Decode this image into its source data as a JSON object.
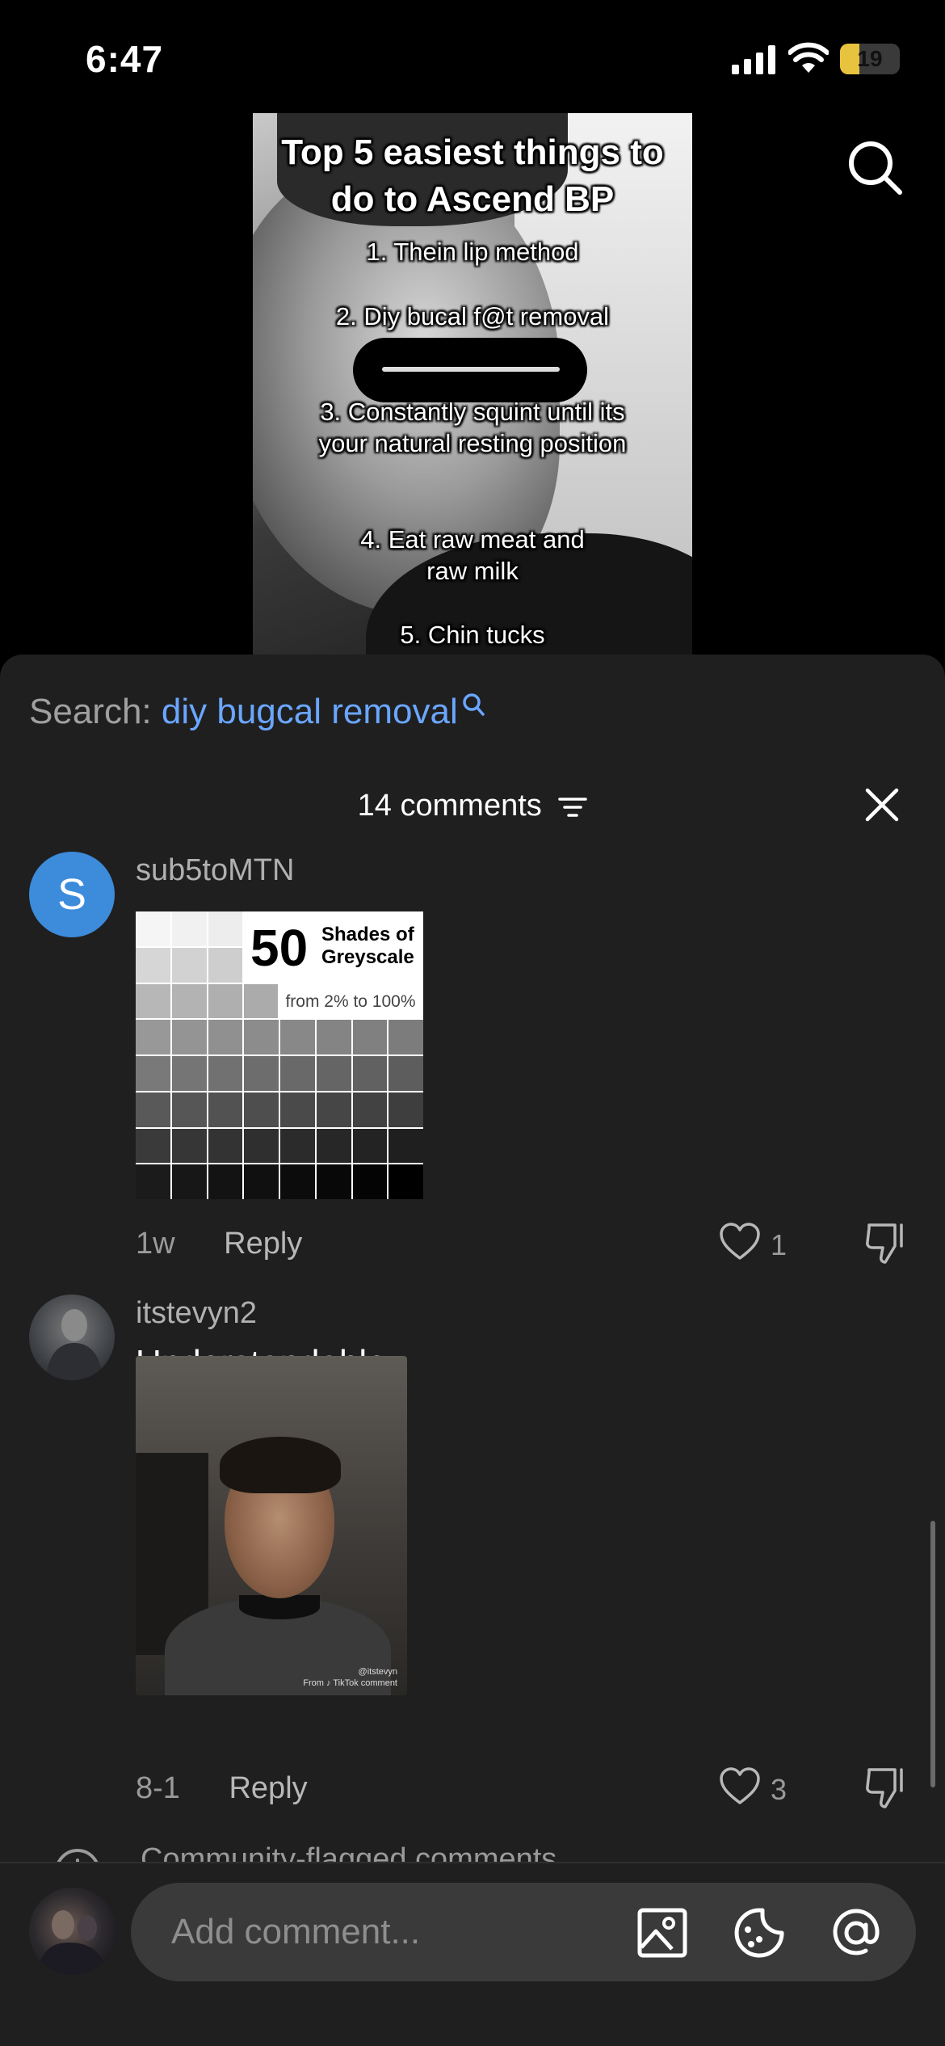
{
  "status_bar": {
    "time": "6:47",
    "battery": "19"
  },
  "video": {
    "title": "Top 5 easiest things to do to Ascend BP",
    "items": [
      "1. Thein lip method",
      "2. Diy bucal f@t removal",
      "3. Constantly squint until its your natural resting position",
      "4. Eat raw meat and raw milk",
      "5. Chin tucks"
    ]
  },
  "search_suggestion": {
    "label": "Search:",
    "term": "diy bugcal removal"
  },
  "comments_header": {
    "count_label": "14 comments"
  },
  "comments": [
    {
      "avatar_letter": "S",
      "username": "sub5toMTN",
      "image": {
        "number": "50",
        "title_line1": "Shades of",
        "title_line2": "Greyscale",
        "subtitle": "from 2% to 100%"
      },
      "time": "1w",
      "reply_label": "Reply",
      "likes": "1"
    },
    {
      "username": "itstevyn2",
      "text": "Understandable",
      "image_watermark": {
        "handle": "@itstevyn",
        "source": "From ♪ TikTok comment"
      },
      "time": "8-1",
      "reply_label": "Reply",
      "likes": "3"
    }
  ],
  "flagged_label": "Community-flagged comments",
  "composer": {
    "placeholder": "Add comment..."
  },
  "colors": {
    "accent_link": "#6aa6ff",
    "sheet_bg": "#1f1f1f",
    "avatar_blue": "#3d8bdb"
  },
  "icons": [
    "search-icon",
    "sort-icon",
    "close-icon",
    "heart-icon",
    "dislike-icon",
    "image-icon",
    "sticker-icon",
    "at-icon",
    "info-icon"
  ]
}
